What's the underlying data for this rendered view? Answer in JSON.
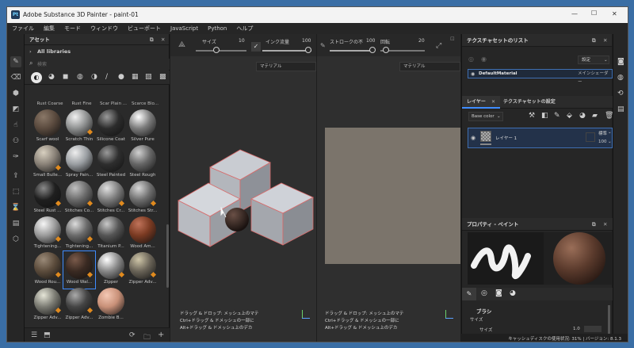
{
  "window": {
    "title": "Adobe Substance 3D Painter - paint-01",
    "app_badge": "Pt",
    "min": "—",
    "max": "☐",
    "close": "✕"
  },
  "menu": [
    "ファイル",
    "編集",
    "モード",
    "ウィンドウ",
    "ビューポート",
    "JavaScript",
    "Python",
    "ヘルプ"
  ],
  "assets": {
    "title": "アセット",
    "library": "All libraries",
    "search_placeholder": "検索",
    "top_labels": [
      "Rust Coarse",
      "Rust Fine",
      "Scar Plain ...",
      "Scarce Blo..."
    ],
    "items": [
      {
        "label": "Scarf wool",
        "color": "#5a4a3e",
        "hl": "#8a7868"
      },
      {
        "label": "Scratch Thin",
        "color": "#8e9090",
        "hl": "#f0f0f0",
        "dot": true
      },
      {
        "label": "Silicone Coat",
        "color": "#2c2c2c",
        "hl": "#9a9a9a"
      },
      {
        "label": "Silver Pure",
        "color": "#7a7a7a",
        "hl": "#ffffff"
      },
      {
        "label": "Small Bulle...",
        "color": "#8a8278",
        "hl": "#d8d0c0",
        "dot": true
      },
      {
        "label": "Spray Pain...",
        "color": "#9a9ea2",
        "hl": "#eeeeee"
      },
      {
        "label": "Steel Painted",
        "color": "#2e2e2e",
        "hl": "#9a9a9a"
      },
      {
        "label": "Steel Rough",
        "color": "#666",
        "hl": "#d0d0d0"
      },
      {
        "label": "Steel Rust ...",
        "color": "#1f1f1f",
        "hl": "#8a8a8a",
        "dot": true
      },
      {
        "label": "Stitches Co...",
        "color": "#6a6a6a",
        "hl": "#c0c0c0",
        "dot": true
      },
      {
        "label": "Stitches Cr...",
        "color": "#7c7c7c",
        "hl": "#e0e0e0",
        "dot": true
      },
      {
        "label": "Stitches Str...",
        "color": "#6e6e6e",
        "hl": "#d8d8d8",
        "dot": true
      },
      {
        "label": "Tightening...",
        "color": "#9a9a9a",
        "hl": "#f6f6f6",
        "dot": true
      },
      {
        "label": "Tightening...",
        "color": "#6a6a6a",
        "hl": "#dcdcdc",
        "dot": true
      },
      {
        "label": "Titanium P...",
        "color": "#555",
        "hl": "#c8c8c8"
      },
      {
        "label": "Wood Am...",
        "color": "#7a3a22",
        "hl": "#c0735a"
      },
      {
        "label": "Wood Rou...",
        "color": "#5c4c3c",
        "hl": "#9a8a78",
        "dot": true
      },
      {
        "label": "Wood Wal...",
        "color": "#3a2a22",
        "hl": "#7a5a4a",
        "selected": true,
        "dot": true
      },
      {
        "label": "Zipper",
        "color": "#888",
        "hl": "#ffffff",
        "dot": true
      },
      {
        "label": "Zipper Adv...",
        "color": "#6a6458",
        "hl": "#cfc6a8",
        "dot": true
      },
      {
        "label": "Zipper Adv...",
        "color": "#7a7a72",
        "hl": "#e6e6d8",
        "dot": true
      },
      {
        "label": "Zipper Adv...",
        "color": "#444",
        "hl": "#aaaaaa",
        "dot": true
      },
      {
        "label": "Zombie B...",
        "color": "#c89078",
        "hl": "#f4c8b4"
      }
    ]
  },
  "toolbar": {
    "size_label": "サイズ",
    "size_value": "10",
    "flow_label": "インク流量",
    "flow_value": "100",
    "stroke_label": "ストロークの不",
    "stroke_value": "100",
    "angle_label": "回転",
    "angle_value": "20",
    "material_label": "マテリアル"
  },
  "viewport_notes": [
    "ドラッグ & ドロップ: メッシュ上のマテ",
    "Ctrl+ドラッグ & ドメッシュの一部に",
    "Alt+ドラッグ & ドメッシュ上のデカ"
  ],
  "textureset_list": {
    "title": "テクスチャセットのリスト",
    "settings_label": "設定",
    "material_name": "DefaultMaterial",
    "shader": "メインシェーダー"
  },
  "layers": {
    "tab1": "レイヤー",
    "tab2": "テクスチャセットの設定",
    "channel": "Base color",
    "layer_name": "レイヤー 1",
    "blend": "標準",
    "opacity": "100"
  },
  "properties": {
    "title": "プロパティ - ペイント",
    "brush_section": "ブラシ",
    "size_label": "サイズ",
    "size_sublabel": "サイズ",
    "size_value": "1.0"
  },
  "status": {
    "text": "キャッシュディスクの使用状況: 31% | バージョン: 8.1.3"
  }
}
